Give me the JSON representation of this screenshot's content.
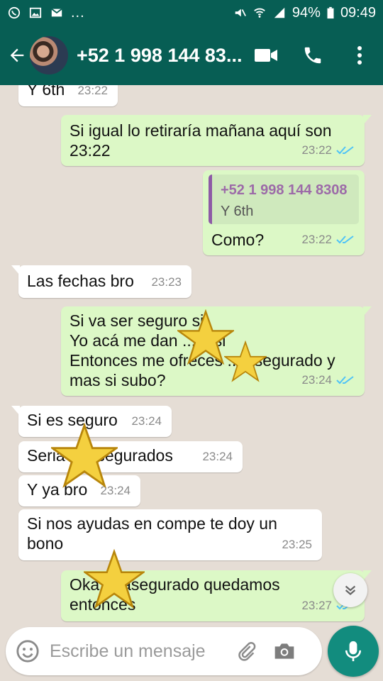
{
  "status_bar": {
    "battery": "94%",
    "time": "09:49",
    "left_icons": [
      "whatsapp-icon",
      "image-icon",
      "mail-icon"
    ],
    "more": "..."
  },
  "header": {
    "contact_name": "+52 1 998 144 83...",
    "actions": [
      "video-call-icon",
      "phone-icon",
      "menu-dots-icon"
    ]
  },
  "colors": {
    "header_bg": "#075e54",
    "outgoing_bubble": "#dcf8c6",
    "incoming_bubble": "#ffffff",
    "read_ticks": "#4fc3f7",
    "mic_button": "#128c7e"
  },
  "messages": [
    {
      "dir": "in",
      "text": "Y 6th",
      "time": "23:22"
    },
    {
      "dir": "out",
      "text": "Si igual lo retiraría  mañana aquí  son 23:22",
      "time": "23:22",
      "status": "read"
    },
    {
      "dir": "out",
      "quote_name": "+52 1 998 144 8308",
      "quote_text": "Y 6th",
      "text": "Como?",
      "time": "23:22",
      "status": "read"
    },
    {
      "dir": "in",
      "text": "Las fechas bro",
      "time": "23:23"
    },
    {
      "dir": "out",
      "text": "Si va ser seguro si\nYo acá me dan ... o si\nEntonces me ofreces ... asegurado  y mas  si subo?",
      "time": "23:24",
      "status": "read"
    },
    {
      "dir": "in",
      "text": "Si es seguro",
      "time": "23:24"
    },
    {
      "dir": "in",
      "text": "Seria ... asegurados",
      "time": "23:24"
    },
    {
      "dir": "in",
      "text": "Y ya bro",
      "time": "23:24"
    },
    {
      "dir": "in",
      "text": "Si nos ayudas en compe te doy un bono",
      "time": "23:25"
    },
    {
      "dir": "out",
      "text": "Oka ... asegurado quedamos entonces",
      "time": "23:27",
      "status": "read"
    }
  ],
  "input": {
    "placeholder": "Escribe un mensaje"
  }
}
